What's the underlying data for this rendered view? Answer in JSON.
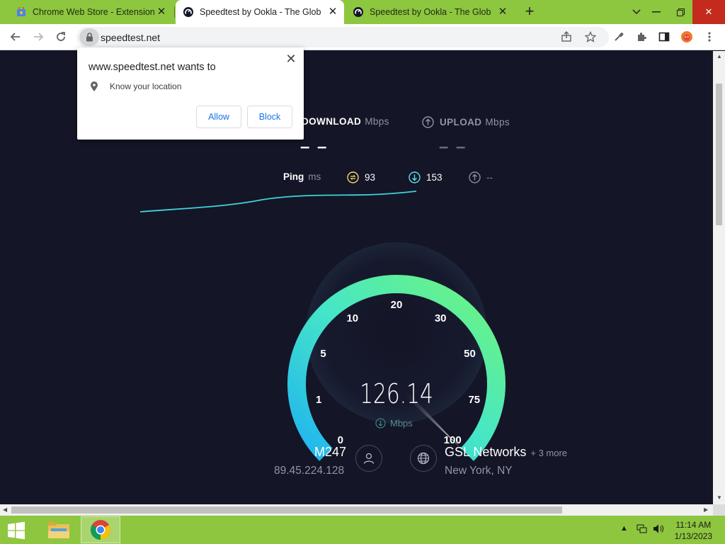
{
  "tabs": [
    {
      "title": "Chrome Web Store - Extensions",
      "active": false,
      "favicon": "chrome-webstore-icon"
    },
    {
      "title": "Speedtest by Ookla - The Global",
      "active": true,
      "favicon": "speedtest-icon"
    },
    {
      "title": "Speedtest by Ookla - The Global",
      "active": false,
      "favicon": "speedtest-icon"
    }
  ],
  "toolbar": {
    "url": "speedtest.net",
    "icons": [
      "back-icon",
      "forward-icon",
      "reload-icon",
      "lock-icon",
      "share-icon",
      "bookmark-star-icon",
      "eyedropper-icon",
      "extensions-icon",
      "side-panel-icon",
      "profile-avatar",
      "menu-icon"
    ]
  },
  "popup": {
    "title": "www.speedtest.net wants to",
    "permission": "Know your location",
    "allow": "Allow",
    "block": "Block"
  },
  "speedtest": {
    "download_label": "DOWNLOAD",
    "download_unit": "Mbps",
    "upload_label": "UPLOAD",
    "upload_unit": "Mbps",
    "download_value": "– –",
    "upload_value": "– –",
    "ping_label": "Ping",
    "ping_unit": "ms",
    "ping_idle": "93",
    "ping_download": "153",
    "ping_upload": "--",
    "gauge_ticks": [
      "0",
      "1",
      "5",
      "10",
      "20",
      "30",
      "50",
      "75",
      "100"
    ],
    "current_speed": "126.14",
    "current_unit": "Mbps",
    "needle_value": 126.14,
    "client_name": "M247",
    "client_ip": "89.45.224.128",
    "host_name": "GSL Networks",
    "host_more": "+ 3 more",
    "host_location": "New York, NY"
  },
  "colors": {
    "page_bg": "#141526",
    "gauge_start": "#1fb3f0",
    "gauge_end": "#6ff57a",
    "tabstrip": "#8dc63f"
  },
  "taskbar": {
    "time": "11:14 AM",
    "date": "1/13/2023",
    "apps": [
      "file-explorer-icon",
      "chrome-icon"
    ]
  }
}
